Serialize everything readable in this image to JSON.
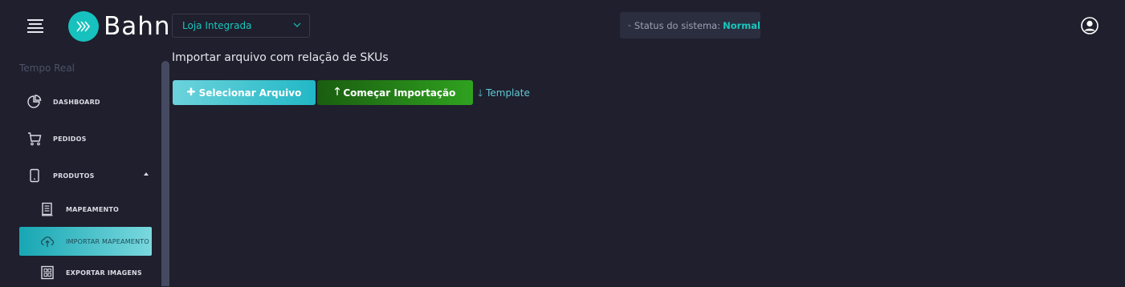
{
  "header": {
    "logo_text": "Bahn",
    "store_select": {
      "value": "Loja Integrada"
    },
    "status": {
      "label": "Status do sistema:",
      "value": "Normal"
    }
  },
  "sidebar": {
    "section_title": "Tempo Real",
    "items": [
      {
        "label": "DASHBOARD",
        "icon": "pie-chart-icon"
      },
      {
        "label": "PEDIDOS",
        "icon": "cart-icon"
      },
      {
        "label": "PRODUTOS",
        "icon": "tablet-icon"
      },
      {
        "label": "MAPEAMENTO",
        "icon": "document-icon"
      },
      {
        "label": "IMPORTAR MAPEAMENTO",
        "icon": "cloud-upload-icon"
      },
      {
        "label": "EXPORTAR IMAGENS",
        "icon": "image-grid-icon"
      }
    ]
  },
  "main": {
    "title": "Importar arquivo com relação de SKUs",
    "select_button": "Selecionar Arquivo",
    "import_button": "Começar Importação",
    "template_link": "Template"
  },
  "colors": {
    "background": "#1f1f2d",
    "accent": "#19c6bd",
    "import_green": "#2fa21f"
  }
}
